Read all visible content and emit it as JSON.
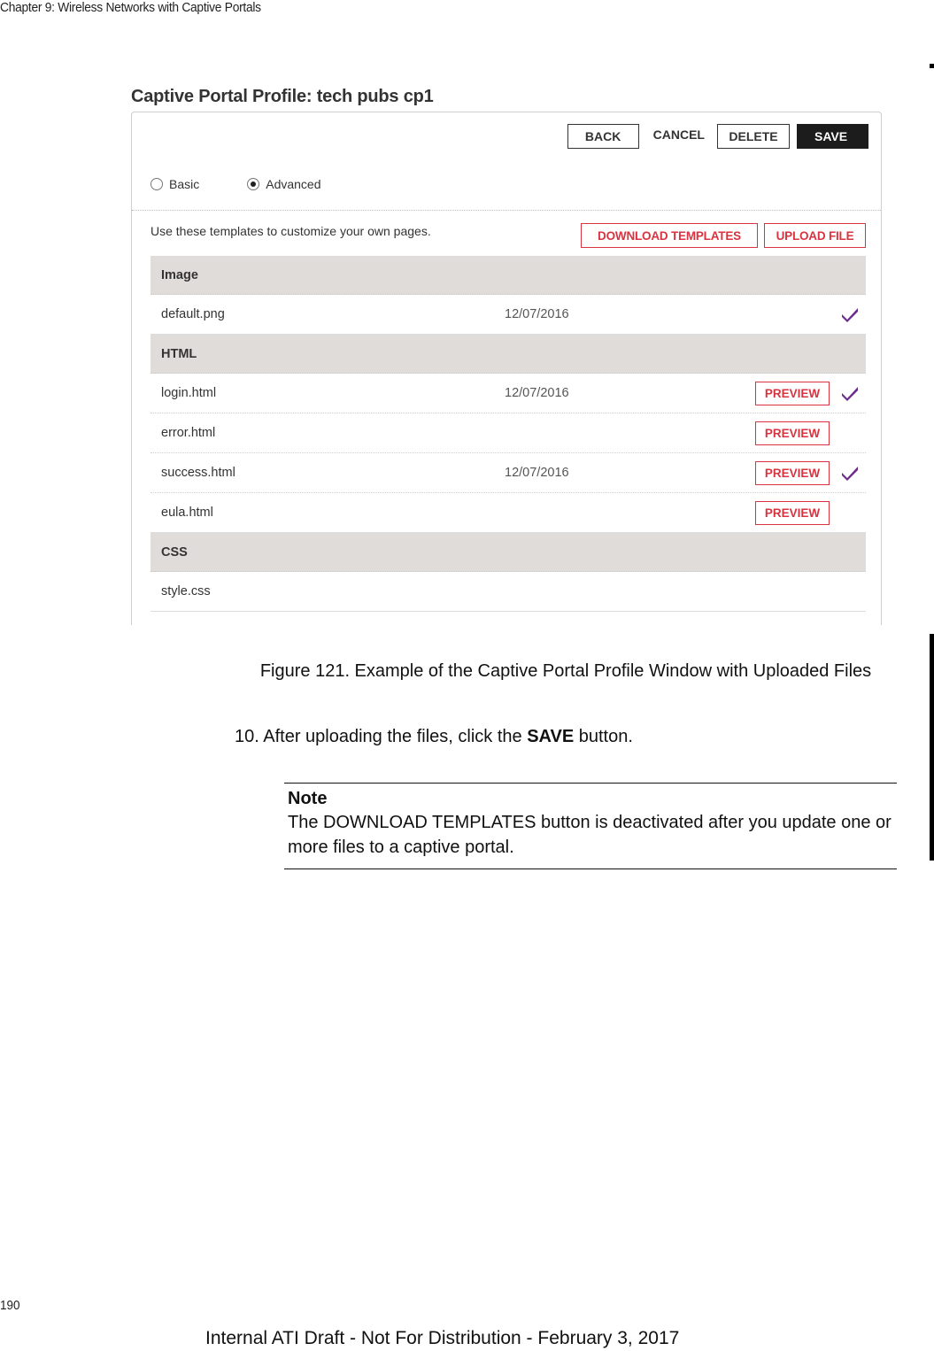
{
  "document": {
    "running_header": "Chapter 9: Wireless Networks with Captive Portals",
    "page_number": "190",
    "footer": "Internal ATI Draft - Not For Distribution - February 3, 2017"
  },
  "figure": {
    "title": "Captive Portal Profile: tech pubs cp1",
    "toolbar": {
      "back_label": "BACK",
      "cancel_label": "CANCEL",
      "delete_label": "DELETE",
      "save_label": "SAVE"
    },
    "mode": {
      "options": [
        {
          "label": "Basic",
          "selected": false
        },
        {
          "label": "Advanced",
          "selected": true
        }
      ]
    },
    "templates_hint": "Use these templates to customize your own pages.",
    "download_templates_label": "DOWNLOAD TEMPLATES",
    "upload_file_label": "UPLOAD FILE",
    "accent_color": "#d9333f",
    "check_color": "#6b2a8c",
    "groups": [
      {
        "name": "Image",
        "files": [
          {
            "name": "default.png",
            "date": "12/07/2016",
            "preview": "",
            "uploaded": true
          }
        ]
      },
      {
        "name": "HTML",
        "files": [
          {
            "name": "login.html",
            "date": "12/07/2016",
            "preview": "PREVIEW",
            "uploaded": true
          },
          {
            "name": "error.html",
            "date": "",
            "preview": "PREVIEW",
            "uploaded": false
          },
          {
            "name": "success.html",
            "date": "12/07/2016",
            "preview": "PREVIEW",
            "uploaded": true
          },
          {
            "name": "eula.html",
            "date": "",
            "preview": "PREVIEW",
            "uploaded": false
          }
        ]
      },
      {
        "name": "CSS",
        "files": [
          {
            "name": "style.css",
            "date": "",
            "preview": "",
            "uploaded": false
          }
        ]
      }
    ]
  },
  "caption": "Figure 121. Example of the Captive Portal Profile Window with Uploaded Files",
  "step": {
    "prefix": "10. After uploading the files, click the ",
    "bold": "SAVE",
    "suffix": " button."
  },
  "note": {
    "title": "Note",
    "body": "The DOWNLOAD TEMPLATES button is deactivated after you update one or more files to a captive portal."
  }
}
